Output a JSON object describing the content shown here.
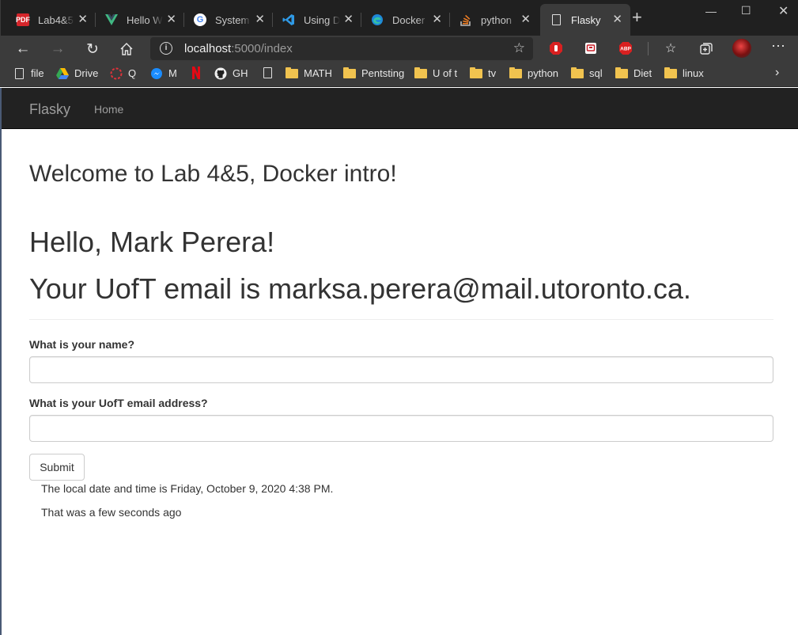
{
  "browser": {
    "tabs": [
      {
        "label": "Lab4&5",
        "icon": "pdf-icon"
      },
      {
        "label": "Hello Wo",
        "icon": "vue-icon"
      },
      {
        "label": "System",
        "icon": "google-icon"
      },
      {
        "label": "Using Do",
        "icon": "vscode-icon"
      },
      {
        "label": "Docker",
        "icon": "edge-icon"
      },
      {
        "label": "python",
        "icon": "stackoverflow-icon"
      },
      {
        "label": "Flasky",
        "icon": "page-icon",
        "active": true
      }
    ],
    "address": {
      "host": "localhost",
      "path": ":5000/index"
    },
    "extensions": {
      "abp_label": "ABP"
    },
    "bookmarks": [
      "file",
      "Drive",
      "Q",
      "M",
      "",
      "GH",
      "",
      "MATH",
      "Pentsting",
      "U of t",
      "tv",
      "python",
      "sql",
      "Diet",
      "linux"
    ]
  },
  "navbar": {
    "brand": "Flasky",
    "home": "Home"
  },
  "main": {
    "welcome": "Welcome to Lab 4&5, Docker intro!",
    "hello": "Hello, Mark Perera!",
    "email_line": "Your UofT email is marksa.perera@mail.utoronto.ca.",
    "form": {
      "name_label": "What is your name?",
      "name_value": "",
      "email_label": "What is your UofT email address?",
      "email_value": "",
      "submit_label": "Submit"
    },
    "datetime_text": "The local date and time is Friday, October 9, 2020 4:38 PM.",
    "relative_text": "That was a few seconds ago"
  }
}
